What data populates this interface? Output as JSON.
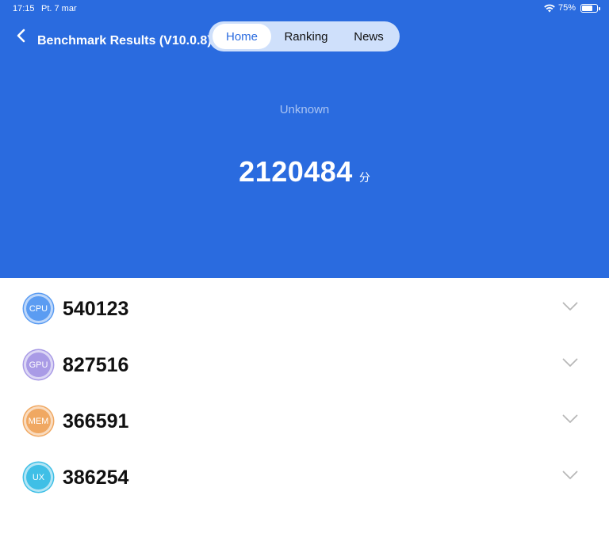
{
  "status_bar": {
    "time": "17:15",
    "date": "Pt. 7 mar",
    "battery_percent": "75%",
    "battery_level": 0.75
  },
  "header": {
    "title": "Benchmark Results (V10.0.8)",
    "tabs": [
      {
        "label": "Home",
        "active": true
      },
      {
        "label": "Ranking",
        "active": false
      },
      {
        "label": "News",
        "active": false
      }
    ],
    "device_name": "Unknown",
    "total_score": "2120484",
    "score_unit": "分"
  },
  "results": [
    {
      "badge": "CPU",
      "score": "540123",
      "color": "#5b9cf2"
    },
    {
      "badge": "GPU",
      "score": "827516",
      "color": "#a99be6"
    },
    {
      "badge": "MEM",
      "score": "366591",
      "color": "#f0a862"
    },
    {
      "badge": "UX",
      "score": "386254",
      "color": "#3fbfe6"
    }
  ],
  "colors": {
    "header_bg": "#2a6bdf",
    "accent": "#2a6bdf"
  }
}
